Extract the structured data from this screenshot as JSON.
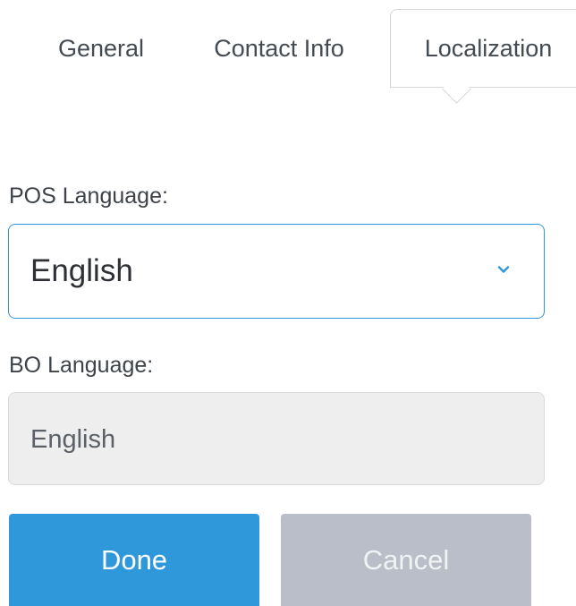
{
  "tabs": {
    "general": "General",
    "contact": "Contact Info",
    "localization": "Localization",
    "active": "Localization"
  },
  "pos_language": {
    "label": "POS Language:",
    "value": "English",
    "icon": "chevron-down-icon"
  },
  "bo_language": {
    "label": "BO Language:",
    "value": "English"
  },
  "actions": {
    "done": "Done",
    "cancel": "Cancel"
  },
  "colors": {
    "accent": "#2f98db",
    "cancel_bg": "#b9bec8",
    "readonly_bg": "#eeeeee"
  }
}
